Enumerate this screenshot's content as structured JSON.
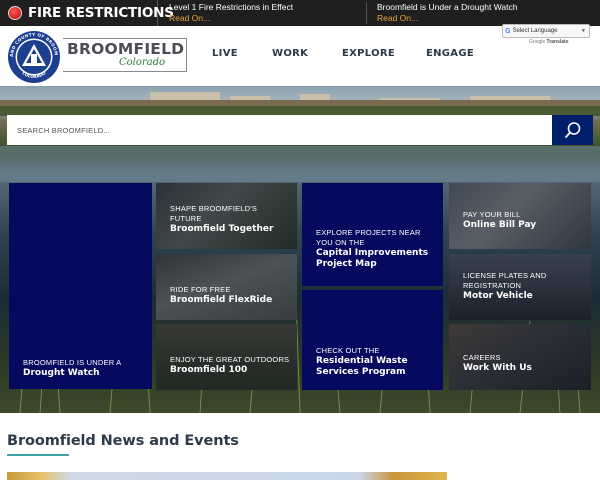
{
  "alert_bar": {
    "title": "FIRE RESTRICTIONS",
    "items": [
      {
        "message": "Level 1 Fire Restrictions in Effect",
        "link": "Read On..."
      },
      {
        "message": "Broomfield is Under a Drought Watch",
        "link": "Read On..."
      }
    ]
  },
  "header": {
    "logo": {
      "wordmark": "BROOMFIELD",
      "script": "Colorado",
      "seal_top": "CITY AND COUNTY OF BROOMFIELD",
      "seal_bottom": "COLORADO"
    },
    "nav": [
      "LIVE",
      "WORK",
      "EXPLORE",
      "ENGAGE"
    ],
    "translate": {
      "select_label": "Select Language",
      "powered_by": "Google",
      "powered_label": "Translate"
    }
  },
  "hero": {
    "search": {
      "placeholder": "SEARCH BROOMFIELD..."
    }
  },
  "tiles": {
    "drought": {
      "kicker": "BROOMFIELD IS UNDER A",
      "headline": "Drought Watch"
    },
    "together": {
      "kicker": "SHAPE BROOMFIELD'S FUTURE",
      "headline": "Broomfield Together"
    },
    "flexride": {
      "kicker": "RIDE FOR FREE",
      "headline": "Broomfield FlexRide"
    },
    "b100": {
      "kicker": "ENJOY THE GREAT OUTDOORS",
      "headline": "Broomfield 100"
    },
    "capital": {
      "kicker": "EXPLORE PROJECTS NEAR YOU ON THE",
      "headline": "Capital Improvements Project Map"
    },
    "waste": {
      "kicker": "CHECK OUT THE",
      "headline": "Residential Waste Services Program"
    },
    "bill": {
      "kicker": "PAY YOUR BILL",
      "headline": "Online Bill Pay"
    },
    "motor": {
      "kicker": "LICENSE PLATES AND REGISTRATION",
      "headline": "Motor Vehicle"
    },
    "careers": {
      "kicker": "CAREERS",
      "headline": "Work With Us"
    }
  },
  "news": {
    "title": "Broomfield News and Events"
  },
  "colors": {
    "navy": "#050a5e",
    "search_button": "#001f6b",
    "alert_link": "#e8a13a",
    "accent_teal": "#3aa6a8"
  },
  "icons": [
    "alert-dot-icon",
    "search-icon",
    "google-g-icon",
    "chevron-down-icon"
  ]
}
